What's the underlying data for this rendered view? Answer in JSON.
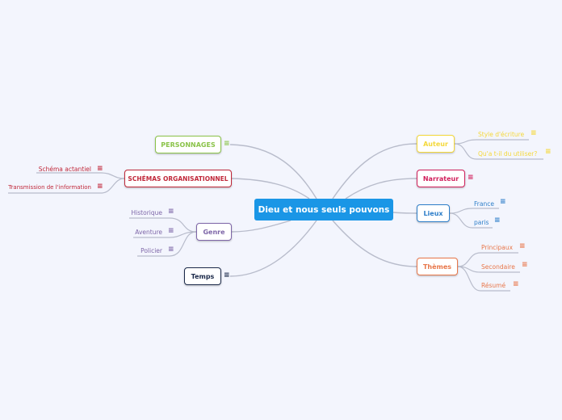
{
  "root": {
    "label": "Dieu et nous seuls pouvons",
    "color": "#1a96e6"
  },
  "left_branches": [
    {
      "id": "personnages",
      "label": "PERSONNAGES",
      "color": "#8bc34a",
      "has_note": true,
      "children": []
    },
    {
      "id": "schemas",
      "label": "SCHÉMAS ORGANISATIONNEL",
      "color": "#c0283a",
      "has_note": false,
      "children": [
        {
          "label": "Schéma actantiel",
          "has_note": true
        },
        {
          "label": "Transmission de l'information",
          "has_note": true
        }
      ]
    },
    {
      "id": "genre",
      "label": "Genre",
      "color": "#7e66a8",
      "has_note": false,
      "children": [
        {
          "label": "Historique",
          "has_note": true
        },
        {
          "label": "Aventure",
          "has_note": true
        },
        {
          "label": "Policier",
          "has_note": true
        }
      ]
    },
    {
      "id": "temps",
      "label": "Temps",
      "color": "#1c2a4a",
      "has_note": true,
      "children": []
    }
  ],
  "right_branches": [
    {
      "id": "auteur",
      "label": "Auteur",
      "color": "#f4d83a",
      "has_note": false,
      "children": [
        {
          "label": "Style d'écriture",
          "has_note": true
        },
        {
          "label": "Qu'a t-il du utiliser?",
          "has_note": true
        }
      ]
    },
    {
      "id": "narrateur",
      "label": "Narrateur",
      "color": "#d11f5b",
      "has_note": true,
      "children": []
    },
    {
      "id": "lieux",
      "label": "Lieux",
      "color": "#2d7ec9",
      "has_note": false,
      "children": [
        {
          "label": "France",
          "has_note": true
        },
        {
          "label": "paris",
          "has_note": true
        }
      ]
    },
    {
      "id": "themes",
      "label": "Thèmes",
      "color": "#e8774a",
      "has_note": false,
      "children": [
        {
          "label": "Principaux",
          "has_note": true
        },
        {
          "label": "Secondaire",
          "has_note": true
        },
        {
          "label": "Résumé",
          "has_note": true
        }
      ]
    }
  ],
  "icons": {
    "note": "≡"
  },
  "link_color": "#b8bccb"
}
